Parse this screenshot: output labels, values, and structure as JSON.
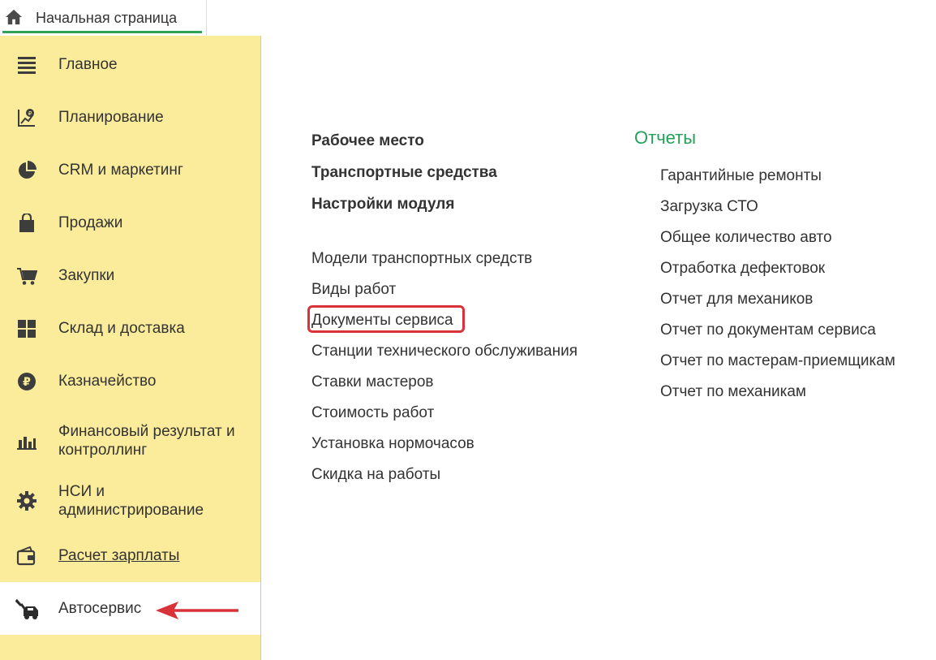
{
  "top_tab": {
    "label": "Начальная страница",
    "icon": "home-icon"
  },
  "sidebar": {
    "items": [
      {
        "label": "Главное",
        "icon": "menu-lines-icon"
      },
      {
        "label": "Планирование",
        "icon": "planning-icon"
      },
      {
        "label": "CRM и маркетинг",
        "icon": "pie-chart-icon"
      },
      {
        "label": "Продажи",
        "icon": "shopping-bag-icon"
      },
      {
        "label": "Закупки",
        "icon": "cart-icon"
      },
      {
        "label": "Склад и доставка",
        "icon": "warehouse-grid-icon"
      },
      {
        "label": "Казначейство",
        "icon": "ruble-coin-icon"
      },
      {
        "label": "Финансовый результат и контроллинг",
        "icon": "bar-chart-icon"
      },
      {
        "label": "НСИ и администрирование",
        "icon": "gear-icon"
      },
      {
        "label": "Расчет зарплаты",
        "icon": "wallet-icon"
      },
      {
        "label": "Автосервис",
        "icon": "car-service-icon"
      }
    ]
  },
  "main": {
    "bold_links": [
      "Рабочее место",
      "Транспортные средства",
      "Настройки модуля"
    ],
    "links": [
      "Модели транспортных средств",
      "Виды работ",
      "Документы сервиса",
      "Станции технического обслуживания",
      "Ставки мастеров",
      "Стоимость работ",
      "Установка нормочасов",
      "Скидка на работы"
    ],
    "reports": {
      "title": "Отчеты",
      "items": [
        "Гарантийные ремонты",
        "Загрузка СТО",
        "Общее количество авто",
        "Отработка дефектовок",
        "Отчет для механиков",
        "Отчет по документам сервиса",
        "Отчет по мастерам-приемщикам",
        "Отчет по механикам"
      ]
    }
  },
  "colors": {
    "sidebar_bg": "#fbec9b",
    "accent_green": "#24a05a",
    "highlight_red": "#d9333a"
  }
}
